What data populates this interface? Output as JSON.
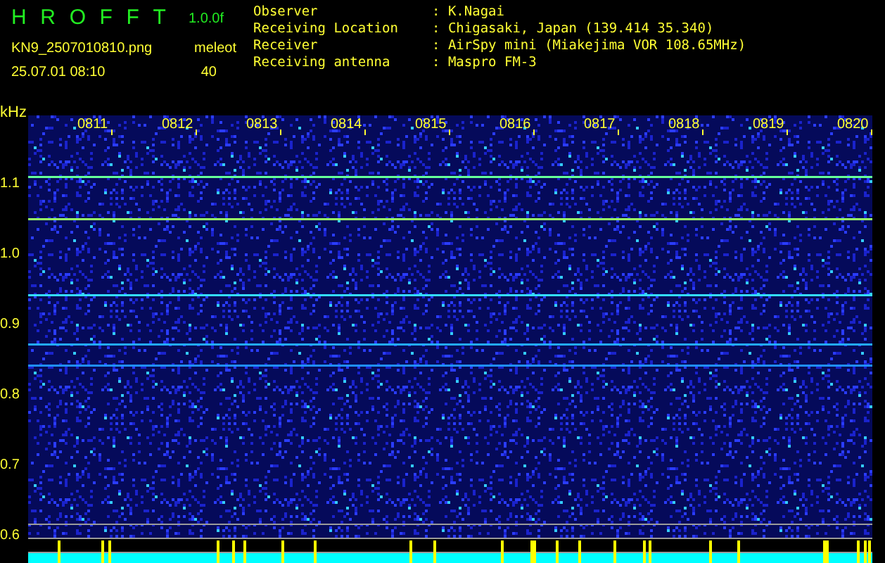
{
  "header": {
    "title_letters": [
      "H",
      "R",
      "O",
      "F",
      "F",
      "T"
    ],
    "version": "1.0.0f",
    "filename": "KN9_2507010810.png",
    "mode": "meleot",
    "timestamp": "25.07.01 08:10",
    "level_value": "40"
  },
  "info": [
    {
      "label": "Observer",
      "value": ": K.Nagai"
    },
    {
      "label": "Receiving Location",
      "value": ": Chigasaki, Japan (139.414 35.340)"
    },
    {
      "label": "Receiver",
      "value": ": AirSpy mini (Miakejima VOR 108.65MHz)"
    },
    {
      "label": "Receiving antenna",
      "value": ": Maspro FM-3"
    }
  ],
  "spectrogram": {
    "unit": "kHz",
    "y_labels": [
      "1.1",
      "1.0",
      "0.9",
      "0.8",
      "0.7",
      "0.6"
    ],
    "time_labels": [
      "0811",
      "0812",
      "0813",
      "0814",
      "0815",
      "0816",
      "0817",
      "0818",
      "0819",
      "0820"
    ]
  }
}
